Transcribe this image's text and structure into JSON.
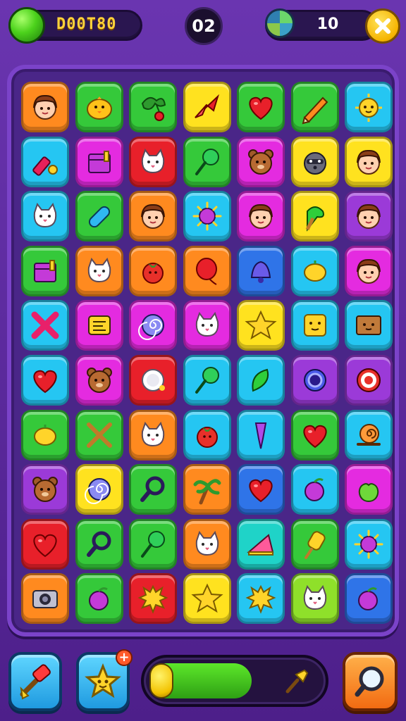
{
  "hud": {
    "score": "D00T80",
    "moves": "02",
    "coins": "10"
  },
  "colors": {
    "orange": "#ff8a1f",
    "green": "#35c93a",
    "yellow": "#ffe21f",
    "cyan": "#25c6f2",
    "magenta": "#e42be0",
    "red": "#e8202a",
    "purple": "#9b3ad8",
    "lime": "#8fe02a",
    "teal": "#1fd3c8",
    "blue": "#2f74e8"
  },
  "board": {
    "rows": [
      [
        {
          "bg": "orange",
          "icon": "girl-face-icon"
        },
        {
          "bg": "green",
          "icon": "chick-icon"
        },
        {
          "bg": "green",
          "icon": "cherry-bird-icon"
        },
        {
          "bg": "yellow",
          "icon": "red-plane-icon"
        },
        {
          "bg": "green",
          "icon": "heart-icon"
        },
        {
          "bg": "green",
          "icon": "pencil-icon"
        },
        {
          "bg": "cyan",
          "icon": "sun-face-icon"
        }
      ],
      [
        {
          "bg": "cyan",
          "icon": "lipstick-icon"
        },
        {
          "bg": "magenta",
          "icon": "box-icon"
        },
        {
          "bg": "red",
          "icon": "cat-face-icon"
        },
        {
          "bg": "green",
          "icon": "lollipop-icon"
        },
        {
          "bg": "magenta",
          "icon": "bear-face-icon"
        },
        {
          "bg": "yellow",
          "icon": "raccoon-face-icon"
        },
        {
          "bg": "yellow",
          "icon": "girl-face-icon"
        }
      ],
      [
        {
          "bg": "cyan",
          "icon": "cat-face-icon"
        },
        {
          "bg": "green",
          "icon": "capsule-icon"
        },
        {
          "bg": "orange",
          "icon": "girl-face-icon"
        },
        {
          "bg": "cyan",
          "icon": "virus-icon"
        },
        {
          "bg": "magenta",
          "icon": "girl-face-icon"
        },
        {
          "bg": "yellow",
          "icon": "ice-cream-icon"
        },
        {
          "bg": "purple",
          "icon": "girl-face-icon"
        }
      ],
      [
        {
          "bg": "green",
          "icon": "box-icon"
        },
        {
          "bg": "orange",
          "icon": "cat-face-icon"
        },
        {
          "bg": "orange",
          "icon": "tomato-icon"
        },
        {
          "bg": "orange",
          "icon": "balloon-icon"
        },
        {
          "bg": "blue",
          "icon": "bell-icon"
        },
        {
          "bg": "cyan",
          "icon": "lemon-icon"
        },
        {
          "bg": "magenta",
          "icon": "girl-face-icon"
        }
      ],
      [
        {
          "bg": "cyan",
          "icon": "x-mark-icon"
        },
        {
          "bg": "magenta",
          "icon": "book-icon"
        },
        {
          "bg": "magenta",
          "icon": "swirl-icon"
        },
        {
          "bg": "magenta",
          "icon": "cat-face-icon"
        },
        {
          "bg": "yellow",
          "icon": "star-icon"
        },
        {
          "bg": "cyan",
          "icon": "square-face-icon"
        },
        {
          "bg": "cyan",
          "icon": "crate-face-icon"
        }
      ],
      [
        {
          "bg": "cyan",
          "icon": "heart-icon"
        },
        {
          "bg": "magenta",
          "icon": "bear-face-icon"
        },
        {
          "bg": "red",
          "icon": "plate-icon"
        },
        {
          "bg": "cyan",
          "icon": "lollipop-icon"
        },
        {
          "bg": "cyan",
          "icon": "leaf-icon"
        },
        {
          "bg": "purple",
          "icon": "ring-icon"
        },
        {
          "bg": "purple",
          "icon": "target-icon"
        }
      ],
      [
        {
          "bg": "green",
          "icon": "lemon-icon"
        },
        {
          "bg": "green",
          "icon": "crossed-sticks-icon"
        },
        {
          "bg": "orange",
          "icon": "cat-face-icon"
        },
        {
          "bg": "cyan",
          "icon": "tomato-icon"
        },
        {
          "bg": "cyan",
          "icon": "crystal-icon"
        },
        {
          "bg": "green",
          "icon": "heart-icon"
        },
        {
          "bg": "cyan",
          "icon": "snail-icon"
        }
      ],
      [
        {
          "bg": "purple",
          "icon": "bear-face-icon"
        },
        {
          "bg": "yellow",
          "icon": "swirl-icon"
        },
        {
          "bg": "green",
          "icon": "magnifier-icon"
        },
        {
          "bg": "orange",
          "icon": "palm-tree-icon"
        },
        {
          "bg": "blue",
          "icon": "heart-icon"
        },
        {
          "bg": "cyan",
          "icon": "plum-icon"
        },
        {
          "bg": "magenta",
          "icon": "apple-icon"
        }
      ],
      [
        {
          "bg": "red",
          "icon": "heart-icon"
        },
        {
          "bg": "green",
          "icon": "magnifier-icon"
        },
        {
          "bg": "green",
          "icon": "lollipop-icon"
        },
        {
          "bg": "orange",
          "icon": "cat-face-icon"
        },
        {
          "bg": "teal",
          "icon": "cheese-icon"
        },
        {
          "bg": "green",
          "icon": "popsicle-icon"
        },
        {
          "bg": "cyan",
          "icon": "virus-icon"
        }
      ],
      [
        {
          "bg": "orange",
          "icon": "camera-icon"
        },
        {
          "bg": "green",
          "icon": "plum-icon"
        },
        {
          "bg": "red",
          "icon": "splat-icon"
        },
        {
          "bg": "yellow",
          "icon": "star-icon"
        },
        {
          "bg": "cyan",
          "icon": "splat-icon"
        },
        {
          "bg": "lime",
          "icon": "cat-face-icon"
        },
        {
          "bg": "blue",
          "icon": "plum-icon"
        }
      ]
    ]
  },
  "bottom": {
    "level_progress": 0.58,
    "powerups": [
      "rocket-hammer-icon",
      "star-boost-icon"
    ],
    "plus_label": "+"
  }
}
